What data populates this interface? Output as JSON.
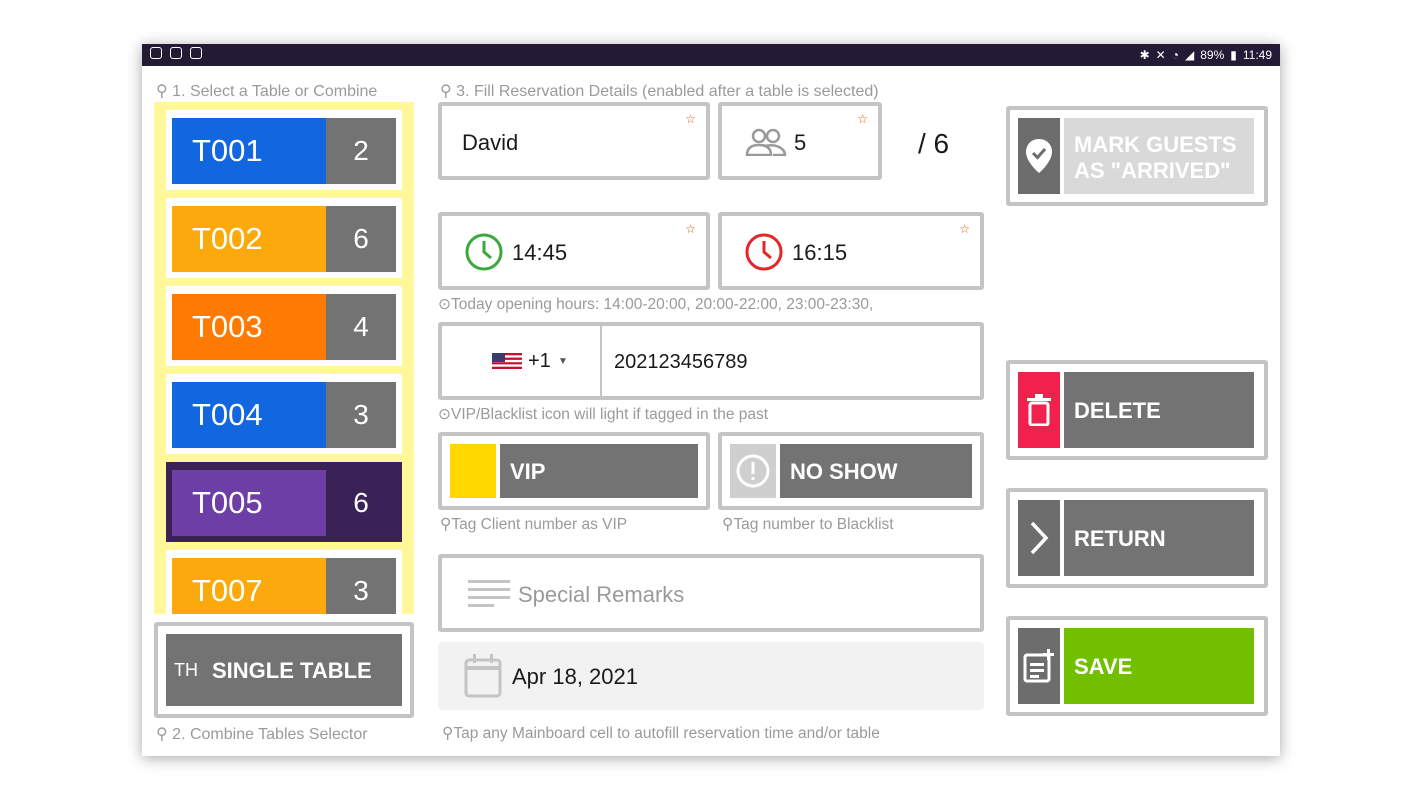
{
  "status_bar": {
    "battery": "89%",
    "time": "11:49"
  },
  "hints": {
    "select_table": "1. Select a Table or Combine",
    "fill_details": "3. Fill Reservation Details (enabled after a table is selected)",
    "opening_hours": "Today opening hours: 14:00-20:00, 20:00-22:00, 23:00-23:30,",
    "vip_blacklist": "VIP/Blacklist icon will light if tagged in the past",
    "tag_vip": "Tag Client number as VIP",
    "tag_blacklist": "Tag number to Blacklist",
    "combine_selector": "2. Combine Tables Selector",
    "tap_mainboard": "Tap any Mainboard cell to autofill reservation time and/or table"
  },
  "tables": [
    {
      "name": "T001",
      "capacity": "2",
      "color": "#1266e0"
    },
    {
      "name": "T002",
      "capacity": "6",
      "color": "#fba90c"
    },
    {
      "name": "T003",
      "capacity": "4",
      "color": "#ff7a00"
    },
    {
      "name": "T004",
      "capacity": "3",
      "color": "#1266e0"
    },
    {
      "name": "T005",
      "capacity": "6",
      "color": "#6d3fa6"
    },
    {
      "name": "T007",
      "capacity": "3",
      "color": "#fba90c"
    }
  ],
  "single_table_button": "SINGLE TABLE",
  "form": {
    "guest_name": "David",
    "guest_count": "5",
    "table_capacity": "/ 6",
    "start_time": "14:45",
    "end_time": "16:15",
    "phone_country_code": "+1",
    "phone_number": "202123456789",
    "vip_label": "VIP",
    "no_show_label": "NO SHOW",
    "remarks_placeholder": "Special Remarks",
    "date": "Apr 18, 2021"
  },
  "actions": {
    "arrived": "MARK GUESTS AS \"ARRIVED\"",
    "delete": "DELETE",
    "return": "RETURN",
    "save": "SAVE"
  },
  "colors": {
    "accent_save": "#72bf00",
    "delete_red": "#f0214c",
    "vip_yellow": "#ffd800",
    "highlight_panel": "#fff79a"
  }
}
